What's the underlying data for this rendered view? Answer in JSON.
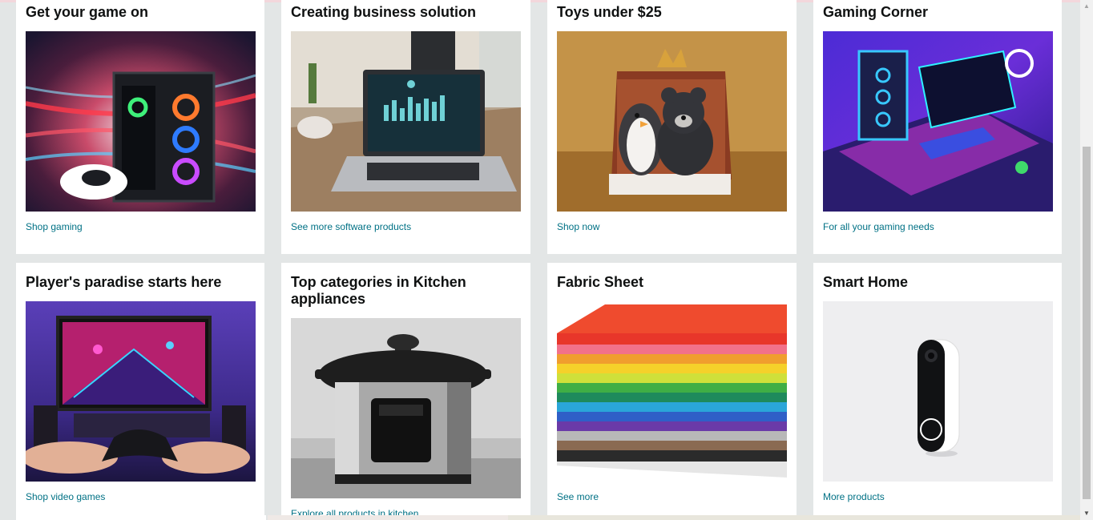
{
  "cards": [
    {
      "title": "Get your game on",
      "link": "Shop gaming",
      "image_icon": "gaming-pc-image"
    },
    {
      "title": "Creating business solution",
      "link": "See more software products",
      "image_icon": "laptop-dashboard-image"
    },
    {
      "title": "Toys under $25",
      "link": "Shop now",
      "image_icon": "plush-toys-image"
    },
    {
      "title": "Gaming Corner",
      "link": "For all your gaming needs",
      "image_icon": "gaming-desk-image"
    },
    {
      "title": "Player's paradise starts here",
      "link": "Shop video games",
      "image_icon": "controller-tv-image"
    },
    {
      "title": "Top categories in Kitchen appliances",
      "link": "Explore all products in kitchen",
      "image_icon": "pressure-cooker-image"
    },
    {
      "title": "Fabric Sheet",
      "link": "See more",
      "image_icon": "felt-sheets-image"
    },
    {
      "title": "Smart Home",
      "link": "More products",
      "image_icon": "video-doorbell-image"
    }
  ],
  "colors": {
    "page_background": "#e3e6e6",
    "card_background": "#ffffff",
    "title_text": "#0f1111",
    "link_text": "#007185"
  }
}
